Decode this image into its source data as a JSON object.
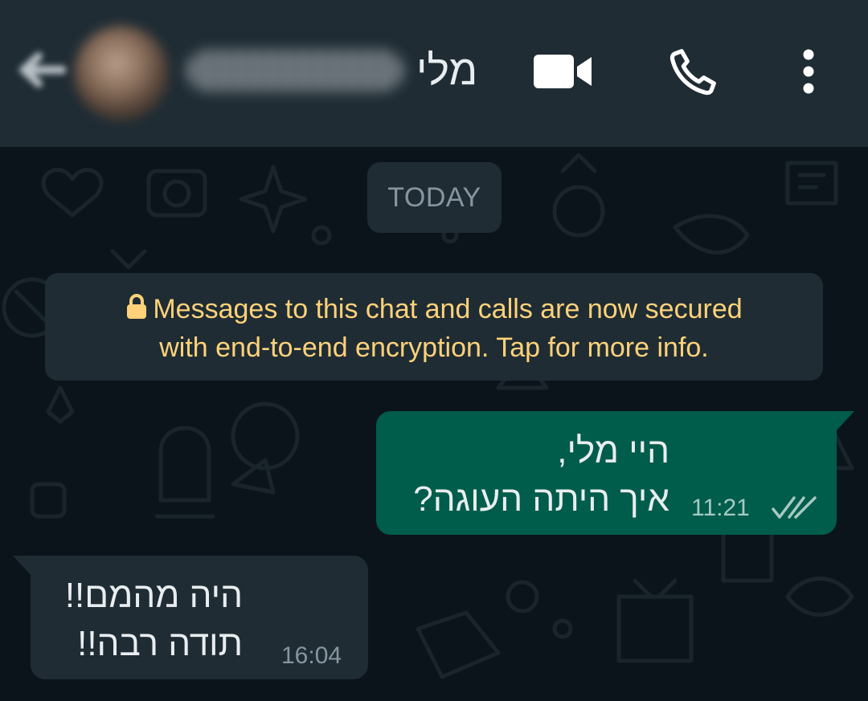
{
  "header": {
    "contact_name": "מלי",
    "icons": [
      "back-arrow-icon",
      "video-call-icon",
      "voice-call-icon",
      "more-options-icon"
    ]
  },
  "chat": {
    "date_chip": "TODAY",
    "system_message": {
      "line1": "Messages to this chat and calls are now secured",
      "line2": "with end-to-end encryption. Tap for more info.",
      "icon": "lock-icon"
    },
    "messages": [
      {
        "direction": "outgoing",
        "lines": [
          "היי מלי,",
          "איך היתה העוגה?"
        ],
        "time": "11:21",
        "status": "read"
      },
      {
        "direction": "incoming",
        "lines": [
          "היה מהמם!!",
          "תודה רבה!!"
        ],
        "time": "16:04"
      }
    ]
  },
  "colors": {
    "header_bg": "#1f2c34",
    "chat_bg": "#0b141a",
    "outgoing_bubble": "#005c4b",
    "incoming_bubble": "#1f2c34",
    "system_text": "#ffd279",
    "read_ticks": "#a6c9c2"
  }
}
